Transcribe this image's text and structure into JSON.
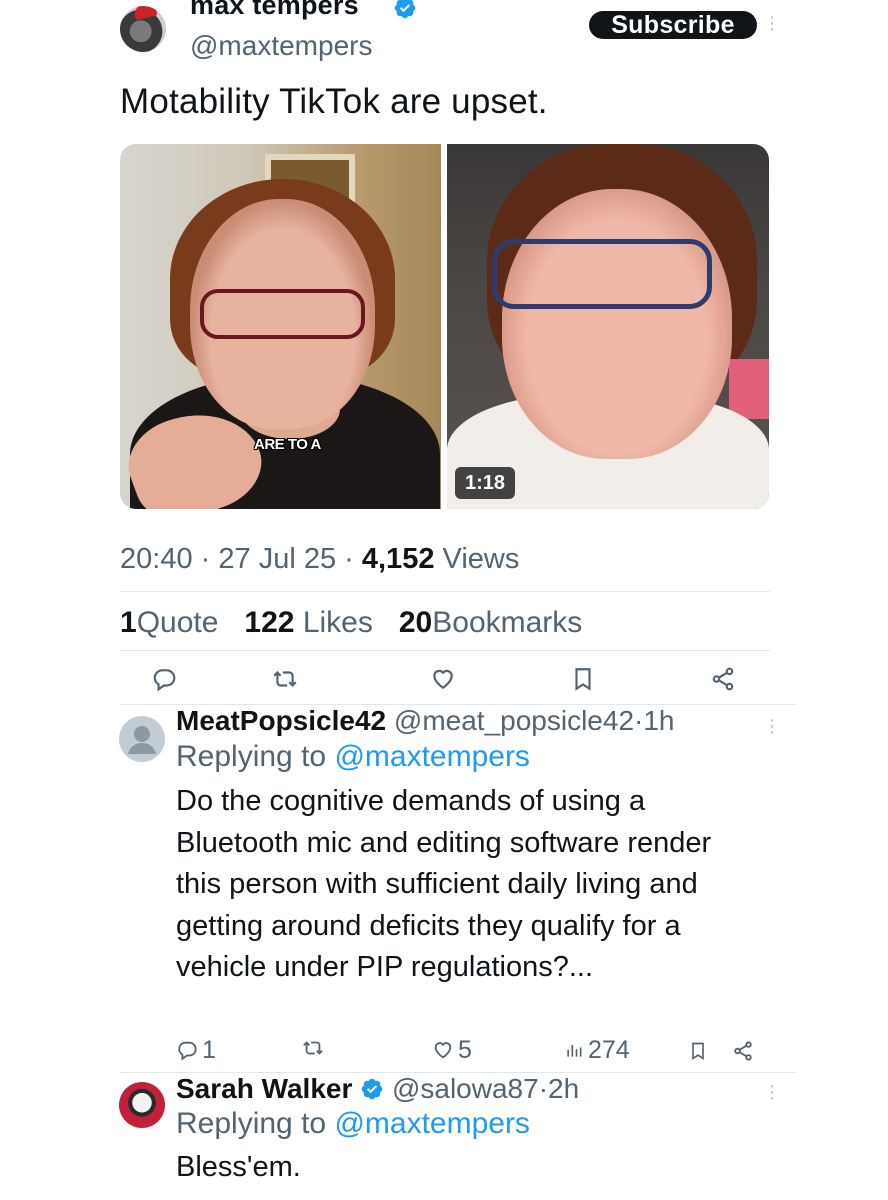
{
  "tweet": {
    "author_name": "max tempers",
    "author_handle": "@maxtempers",
    "subscribe_label": "Subscribe",
    "text": "Motability TikTok are upset.",
    "media": {
      "left_caption": "ARE TO A",
      "duration": "1:18"
    },
    "time": "20:40",
    "date": "27 Jul 25",
    "views_count": "4,152",
    "views_label": "Views",
    "stats": {
      "quotes_count": "1",
      "quotes_label": "Quote",
      "likes_count": "122",
      "likes_label": "Likes",
      "bookmarks_count": "20",
      "bookmarks_label": "Bookmarks"
    },
    "separator": "·"
  },
  "replies": [
    {
      "name": "MeatPopsicle42",
      "handle": "@meat_popsicle42",
      "time": "1h",
      "replying_prefix": "Replying to",
      "replying_to": "@maxtempers",
      "text": "Do the cognitive demands of using a Bluetooth mic and editing software render this person with sufficient daily living and getting around deficits they qualify for a vehicle under PIP regulations?...",
      "reply_count": "1",
      "like_count": "5",
      "view_count": "274",
      "verified": false
    },
    {
      "name": "Sarah Walker",
      "handle": "@salowa87",
      "time": "2h",
      "replying_prefix": "Replying to",
      "replying_to": "@maxtempers",
      "text": "Bless'em.",
      "verified": true
    }
  ],
  "colors": {
    "accent": "#1d9bf0",
    "text": "#0f1419",
    "secondary": "#536471",
    "verified": "#1d9bf0"
  }
}
